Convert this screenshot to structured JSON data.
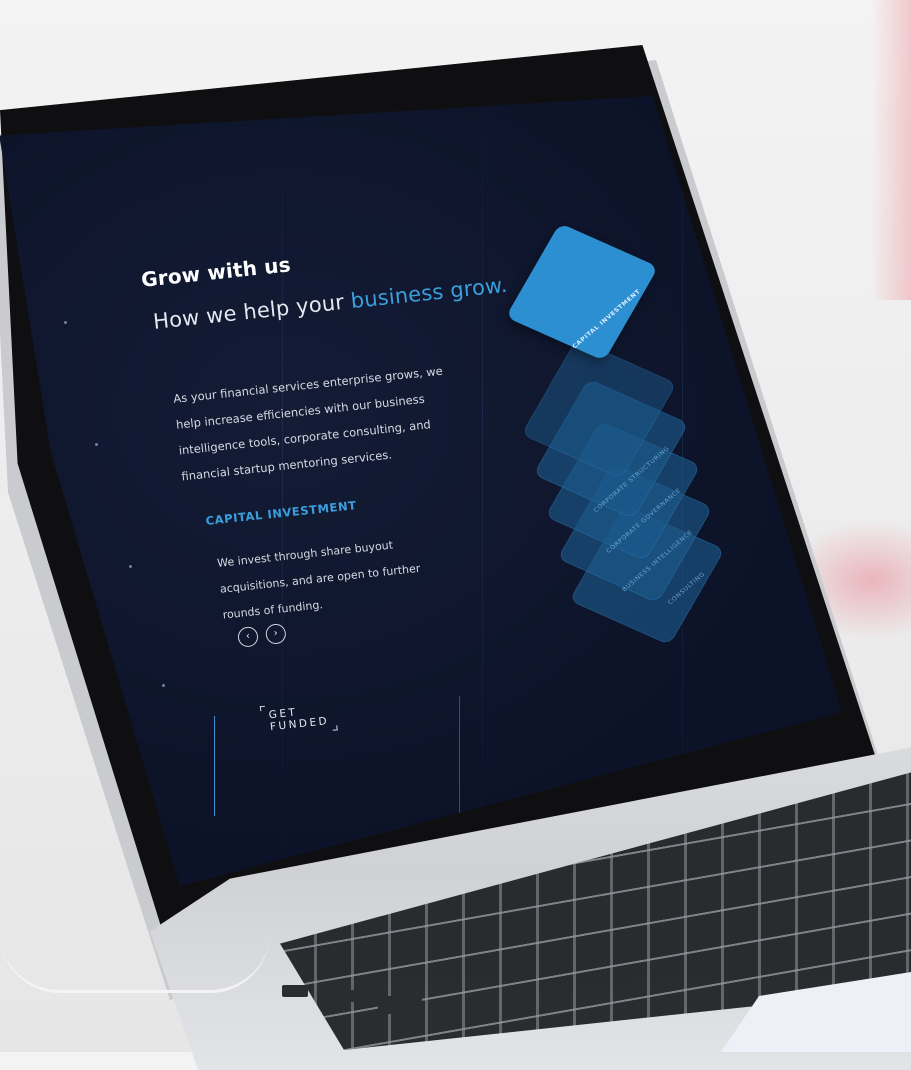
{
  "hero": {
    "title": "Grow with us",
    "subtitle_prefix": "How we help your ",
    "subtitle_highlight": "business grow.",
    "body": "As your financial services enterprise grows, we help increase efficiencies with our business intelligence tools, corporate consulting, and financial startup mentoring services."
  },
  "service": {
    "title": "CAPITAL INVESTMENT",
    "description": "We invest through share buyout acquisitions, and are open to further rounds of funding."
  },
  "carousel": {
    "prev_glyph": "‹",
    "next_glyph": "›"
  },
  "cta": {
    "label": "GET FUNDED"
  },
  "cards": [
    {
      "label": "CAPITAL INVESTMENT",
      "active": true
    },
    {
      "label": "CORPORATE STRUCTURING",
      "active": false
    },
    {
      "label": "CORPORATE GOVERNANCE",
      "active": false
    },
    {
      "label": "BUSINESS INTELLIGENCE",
      "active": false
    },
    {
      "label": "CONSULTING",
      "active": false
    }
  ],
  "colors": {
    "accent": "#3aa0dd",
    "card_active": "#2c8fd1",
    "screen_bg": "#0d142a"
  }
}
